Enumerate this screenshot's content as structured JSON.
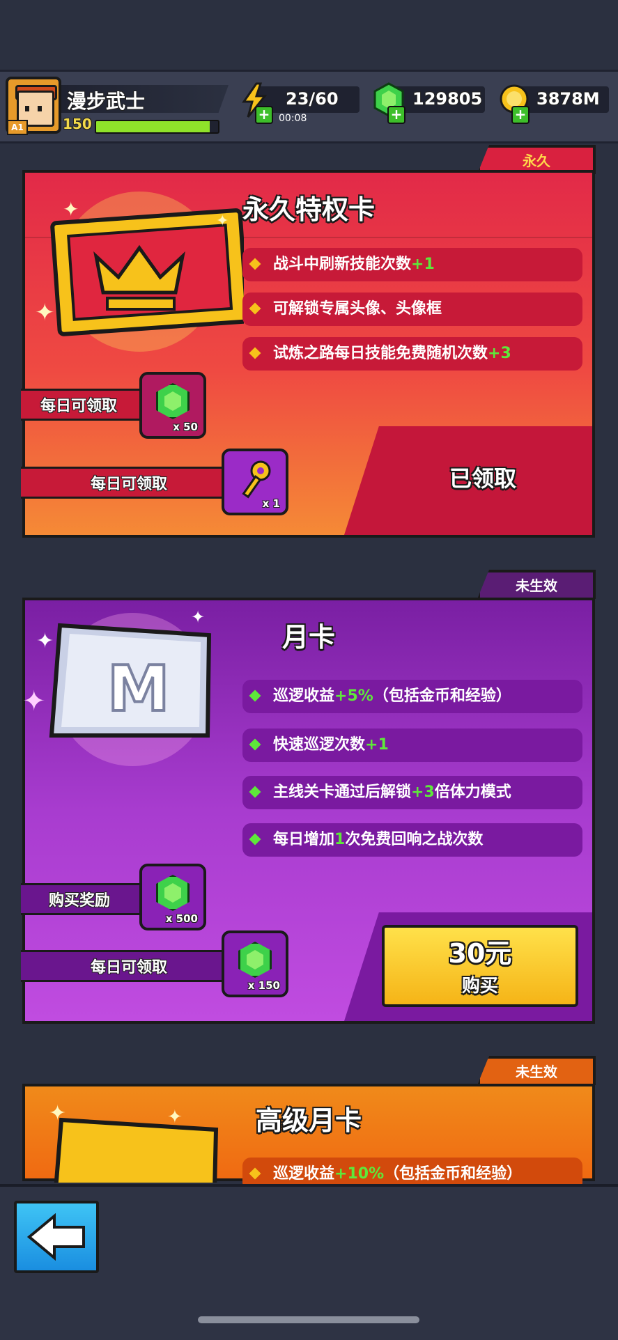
{
  "player": {
    "name": "漫步武士",
    "level": "150",
    "rank": "A1",
    "xp_fraction": 0.93
  },
  "resources": {
    "energy": "23/60",
    "energy_timer": "00:08",
    "gems": "129805",
    "coins": "3878M"
  },
  "cards": [
    {
      "tag": "永久",
      "title": "永久特权卡",
      "benefits": [
        {
          "text": "战斗中刷新技能次数",
          "highlight": "+1",
          "suffix": ""
        },
        {
          "text": "可解锁专属头像、头像框",
          "highlight": "",
          "suffix": ""
        },
        {
          "text": "试炼之路每日技能免费随机次数",
          "highlight": "+3",
          "suffix": ""
        }
      ],
      "rewards": [
        {
          "label": "每日可领取",
          "qty": "x 50",
          "icon": "gem-icon"
        },
        {
          "label": "每日可领取",
          "qty": "x 1",
          "icon": "key-icon"
        }
      ],
      "action": "已领取"
    },
    {
      "tag": "未生效",
      "title": "月卡",
      "benefits": [
        {
          "text": "巡逻收益",
          "highlight": "+5%",
          "suffix": "（包括金币和经验）"
        },
        {
          "text": "快速巡逻次数",
          "highlight": "+1",
          "suffix": ""
        },
        {
          "text": "主线关卡通过后解锁",
          "highlight": "+3",
          "suffix": "倍体力模式"
        },
        {
          "text": "每日增加",
          "highlight": "1",
          "suffix": "次免费回响之战次数"
        }
      ],
      "rewards": [
        {
          "label": "购买奖励",
          "qty": "x 500",
          "icon": "gem-icon"
        },
        {
          "label": "每日可领取",
          "qty": "x 150",
          "icon": "gem-icon"
        }
      ],
      "price": "30元",
      "buy_label": "购买"
    },
    {
      "tag": "未生效",
      "title": "高级月卡",
      "benefits": [
        {
          "text": "巡逻收益",
          "highlight": "+10%",
          "suffix": "（包括金币和经验）"
        }
      ]
    }
  ],
  "colors": {
    "permanent": "#d9213f",
    "monthly": "#9b2bc7",
    "premium": "#f07a12",
    "accent_green": "#5ee83a"
  }
}
